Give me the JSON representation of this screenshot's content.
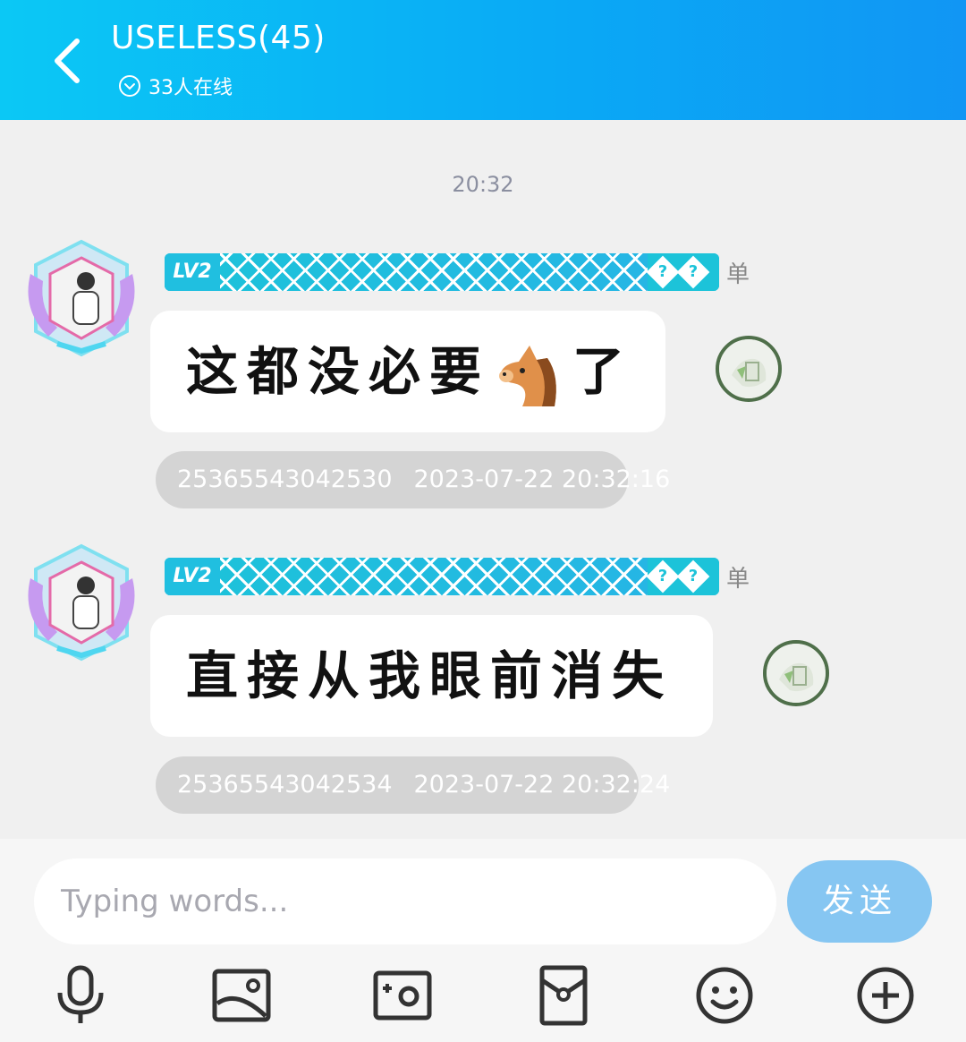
{
  "header": {
    "title": "USELESS(45)",
    "online_text": "33人在线"
  },
  "time_divider": "20:32",
  "messages": [
    {
      "level": "LV2",
      "badge_marks": [
        "?",
        "?"
      ],
      "side_label": "单",
      "text": "这都没必要",
      "emoji": "horse-face",
      "text_after": "了",
      "meta_id": "25365543042530",
      "meta_time": "2023-07-22 20:32:16"
    },
    {
      "level": "LV2",
      "badge_marks": [
        "?",
        "?"
      ],
      "side_label": "单",
      "text": "直接从我眼前消失",
      "meta_id": "25365543042534",
      "meta_time": "2023-07-22 20:32:24"
    }
  ],
  "composer": {
    "placeholder": "Typing words...",
    "send_label": "发送"
  },
  "toolbar": {
    "icons": [
      "microphone-icon",
      "image-icon",
      "camera-icon",
      "red-packet-icon",
      "emoji-icon",
      "plus-icon"
    ]
  },
  "colors": {
    "header_start": "#0bc8f5",
    "header_end": "#1196f4",
    "send_button": "#86c6f2",
    "badge": "#1cc3d9"
  }
}
